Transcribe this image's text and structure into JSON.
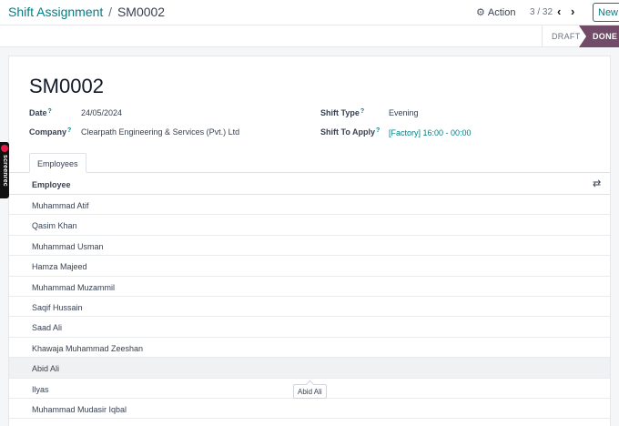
{
  "header": {
    "breadcrumb_parent": "Shift Assignment",
    "breadcrumb_separator": "/",
    "record_ref": "SM0002",
    "action_label": "Action",
    "pager_text": "3 / 32",
    "new_label": "New"
  },
  "status": {
    "draft_label": "DRAFT",
    "done_label": "DONE",
    "active_color": "#714b67"
  },
  "record": {
    "name": "SM0002",
    "date_label": "Date",
    "date_value": "24/05/2024",
    "company_label": "Company",
    "company_value": "Clearpath Engineering & Services (Pvt.) Ltd",
    "shift_type_label": "Shift Type",
    "shift_type_value": "Evening",
    "shift_apply_label": "Shift To Apply",
    "shift_apply_value": "[Factory] 16:00 - 00:00",
    "help_mark": "?"
  },
  "tabs": {
    "employees": "Employees"
  },
  "table": {
    "column_employee": "Employee",
    "rows": [
      "Muhammad Atif",
      "Qasim Khan",
      "Muhammad Usman",
      "Hamza Majeed",
      "Muhammad Muzammil",
      "Saqif Hussain",
      "Saad Ali",
      "Khawaja Muhammad Zeeshan",
      "Abid Ali",
      "Ilyas",
      "Muhammad Mudasir Iqbal"
    ],
    "hovered_row": 8
  },
  "tooltip": {
    "text": "Abid Ali"
  },
  "overlay": {
    "brand_text": "screenrec"
  },
  "icons": {
    "gear": "gear-icon",
    "prev": "chevron-left-icon",
    "next": "chevron-right-icon",
    "columns": "column-toggle-icon"
  }
}
